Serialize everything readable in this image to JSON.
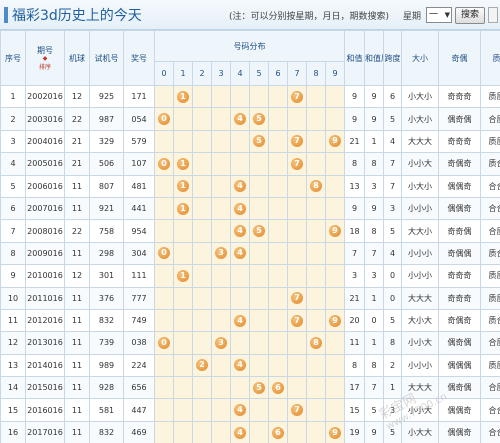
{
  "header": {
    "title": "福彩3d历史上的今天",
    "hint": "(注：可以分别按星期，月日，期数搜索)",
    "week_label": "星期",
    "week_value": "一",
    "search_label": "搜索"
  },
  "columns": {
    "seq": "序号",
    "period": "期号",
    "sort": "排序",
    "machine": "机球",
    "test_number": "试机号",
    "award": "奖号",
    "distribution": "号码分布",
    "digits": [
      "0",
      "1",
      "2",
      "3",
      "4",
      "5",
      "6",
      "7",
      "8",
      "9"
    ],
    "sum": "和值",
    "sum_tail": "和值尾",
    "span": "跨度",
    "big_small": "大小",
    "odd_even": "奇偶",
    "prime": "质合"
  },
  "rows": [
    {
      "seq": "1",
      "period": "2002016",
      "machine": "12",
      "test": "925",
      "award": "171",
      "balls": [
        1,
        7
      ],
      "labels": [
        "1",
        "7"
      ],
      "sum": "9",
      "tail": "9",
      "span": "6",
      "bs": "小大小",
      "oe": "奇奇奇",
      "pr": "质质质"
    },
    {
      "seq": "2",
      "period": "2003016",
      "machine": "22",
      "test": "987",
      "award": "054",
      "balls": [
        0,
        4,
        5
      ],
      "labels": [
        "0",
        "4",
        "5"
      ],
      "sum": "9",
      "tail": "9",
      "span": "5",
      "bs": "小大小",
      "oe": "偶奇偶",
      "pr": "合质合"
    },
    {
      "seq": "3",
      "period": "2004016",
      "machine": "21",
      "test": "329",
      "award": "579",
      "balls": [
        5,
        7,
        9
      ],
      "labels": [
        "5",
        "7",
        "9"
      ],
      "sum": "21",
      "tail": "1",
      "span": "4",
      "bs": "大大大",
      "oe": "奇奇奇",
      "pr": "质质合"
    },
    {
      "seq": "4",
      "period": "2005016",
      "machine": "21",
      "test": "506",
      "award": "107",
      "balls": [
        0,
        1,
        7
      ],
      "labels": [
        "0",
        "1",
        "7"
      ],
      "sum": "8",
      "tail": "8",
      "span": "7",
      "bs": "小小大",
      "oe": "奇偶奇",
      "pr": "质合质"
    },
    {
      "seq": "5",
      "period": "2006016",
      "machine": "11",
      "test": "807",
      "award": "481",
      "balls": [
        1,
        4,
        8
      ],
      "labels": [
        "1",
        "4",
        "8"
      ],
      "sum": "13",
      "tail": "3",
      "span": "7",
      "bs": "小大小",
      "oe": "偶偶奇",
      "pr": "合合质"
    },
    {
      "seq": "6",
      "period": "2007016",
      "machine": "11",
      "test": "921",
      "award": "441",
      "balls": [
        1,
        4
      ],
      "labels": [
        "1",
        "4"
      ],
      "sum": "9",
      "tail": "9",
      "span": "3",
      "bs": "小小小",
      "oe": "偶偶奇",
      "pr": "合合质"
    },
    {
      "seq": "7",
      "period": "2008016",
      "machine": "22",
      "test": "758",
      "award": "954",
      "balls": [
        4,
        5,
        9
      ],
      "labels": [
        "4",
        "5",
        "9"
      ],
      "sum": "18",
      "tail": "8",
      "span": "5",
      "bs": "大大小",
      "oe": "奇奇偶",
      "pr": "合质合"
    },
    {
      "seq": "8",
      "period": "2009016",
      "machine": "11",
      "test": "298",
      "award": "304",
      "balls": [
        0,
        3,
        4
      ],
      "labels": [
        "0",
        "3",
        "4"
      ],
      "sum": "7",
      "tail": "7",
      "span": "4",
      "bs": "小小小",
      "oe": "奇偶偶",
      "pr": "质合合"
    },
    {
      "seq": "9",
      "period": "2010016",
      "machine": "12",
      "test": "301",
      "award": "111",
      "balls": [
        1
      ],
      "labels": [
        "1"
      ],
      "sum": "3",
      "tail": "3",
      "span": "0",
      "bs": "小小小",
      "oe": "奇奇奇",
      "pr": "质质质"
    },
    {
      "seq": "10",
      "period": "2011016",
      "machine": "11",
      "test": "376",
      "award": "777",
      "balls": [
        7
      ],
      "labels": [
        "7"
      ],
      "sum": "21",
      "tail": "1",
      "span": "0",
      "bs": "大大大",
      "oe": "奇奇奇",
      "pr": "质质质"
    },
    {
      "seq": "11",
      "period": "2012016",
      "machine": "11",
      "test": "832",
      "award": "749",
      "balls": [
        4,
        7,
        9
      ],
      "labels": [
        "4",
        "7",
        "9"
      ],
      "sum": "20",
      "tail": "0",
      "span": "5",
      "bs": "大小大",
      "oe": "奇偶奇",
      "pr": "质合合"
    },
    {
      "seq": "12",
      "period": "2013016",
      "machine": "11",
      "test": "739",
      "award": "038",
      "balls": [
        0,
        3,
        8
      ],
      "labels": [
        "0",
        "3",
        "8"
      ],
      "sum": "11",
      "tail": "1",
      "span": "8",
      "bs": "小小大",
      "oe": "偶奇偶",
      "pr": "合质合"
    },
    {
      "seq": "13",
      "period": "2014016",
      "machine": "11",
      "test": "989",
      "award": "224",
      "balls": [
        2,
        4
      ],
      "labels": [
        "2",
        "4"
      ],
      "sum": "8",
      "tail": "8",
      "span": "2",
      "bs": "小小小",
      "oe": "偶偶偶",
      "pr": "质质合"
    },
    {
      "seq": "14",
      "period": "2015016",
      "machine": "11",
      "test": "928",
      "award": "656",
      "balls": [
        5,
        6
      ],
      "labels": [
        "5",
        "6"
      ],
      "sum": "17",
      "tail": "7",
      "span": "1",
      "bs": "大大大",
      "oe": "偶奇偶",
      "pr": "合质合"
    },
    {
      "seq": "15",
      "period": "2016016",
      "machine": "11",
      "test": "581",
      "award": "447",
      "balls": [
        4,
        7
      ],
      "labels": [
        "4",
        "7"
      ],
      "sum": "15",
      "tail": "5",
      "span": "3",
      "bs": "小小大",
      "oe": "偶偶奇",
      "pr": "合合质"
    },
    {
      "seq": "16",
      "period": "2017016",
      "machine": "11",
      "test": "832",
      "award": "469",
      "balls": [
        4,
        6,
        9
      ],
      "labels": [
        "4",
        "6",
        "9"
      ],
      "sum": "19",
      "tail": "9",
      "span": "5",
      "bs": "小大大",
      "oe": "偶偶奇",
      "pr": "合合合"
    }
  ],
  "watermark": {
    "brand": "彩宝网",
    "url": "www.7500.cn"
  }
}
